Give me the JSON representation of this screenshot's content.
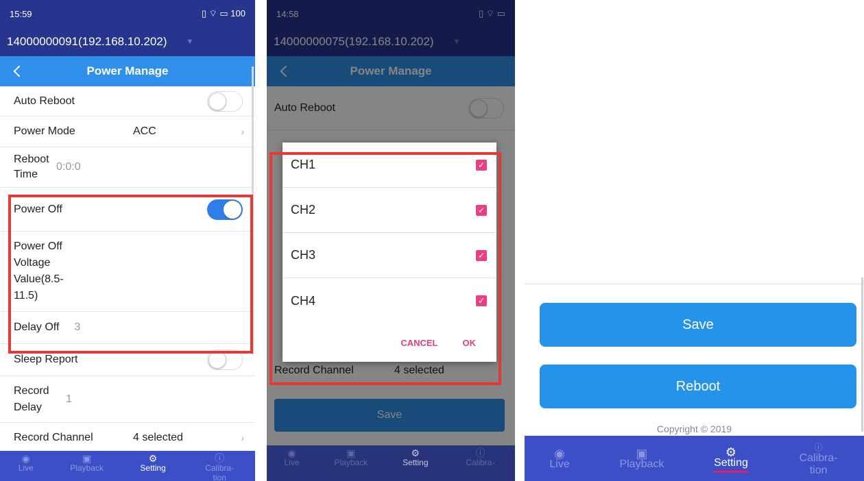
{
  "panel1": {
    "status_time": "15:59",
    "status_right": "▯ ⌔ ▭ 100",
    "device": "14000000091(192.168.10.202)",
    "title": "Power Manage",
    "rows": {
      "auto_reboot": "Auto Reboot",
      "power_mode": "Power Mode",
      "power_mode_value": "ACC",
      "reboot_time": "Reboot Time",
      "reboot_time_value": "0:0:0",
      "power_off": "Power Off",
      "power_off_voltage": "Power Off Voltage Value(8.5-11.5)",
      "delay_off": "Delay Off",
      "delay_off_value": "3",
      "sleep_report": "Sleep Report",
      "record_delay": "Record Delay",
      "record_delay_value": "1",
      "record_channel": "Record Channel",
      "record_channel_value": "4 selected"
    },
    "toggles": {
      "auto_reboot": false,
      "power_off": true,
      "sleep_report": false
    }
  },
  "panel2": {
    "status_time": "14:58",
    "status_right": "▯ ⌔ ▭",
    "device": "14000000075(192.168.10.202)",
    "title": "Power Manage",
    "auto_reboot": "Auto Reboot",
    "record_channel": "Record Channel",
    "record_channel_value": "4 selected",
    "save": "Save",
    "dialog": {
      "channels": [
        "CH1",
        "CH2",
        "CH3",
        "CH4"
      ],
      "cancel": "CANCEL",
      "ok": "OK"
    }
  },
  "panel3": {
    "save": "Save",
    "reboot": "Reboot",
    "copyright": "Copyright © 2019"
  },
  "nav": {
    "live": "Live",
    "playback": "Playback",
    "setting": "Setting",
    "calibration": "Calibra-tion"
  },
  "colors": {
    "accent": "#2f8fea",
    "header": "#27358e",
    "nav": "#3d4fc6",
    "highlight": "#e53935",
    "check": "#ea3f84"
  }
}
